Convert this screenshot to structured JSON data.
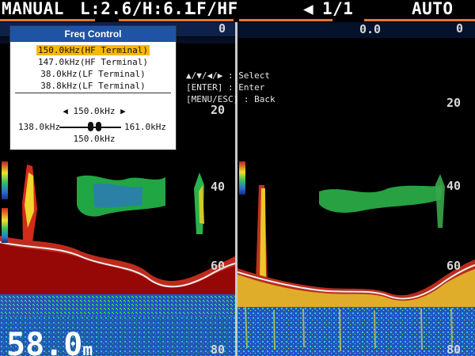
{
  "status_bar": {
    "mode": "MANUAL",
    "range": "L:2.6/H:6.1",
    "frequency_mode": "LF/HF",
    "page": "1/1",
    "gain_mode": "AUTO"
  },
  "left_panel": {
    "depth_labels": [
      "0",
      "20",
      "40",
      "60",
      "80"
    ],
    "depth_readout": "58.0",
    "depth_unit": "m"
  },
  "right_panel": {
    "top_label": "0.0",
    "depth_labels": [
      "0",
      "20",
      "40",
      "60",
      "80"
    ]
  },
  "freq_menu": {
    "title": "Freq Control",
    "items": [
      {
        "label": "150.0kHz(HF Terminal)",
        "selected": true
      },
      {
        "label": "147.0kHz(HF Terminal)",
        "selected": false
      },
      {
        "label": "38.0kHz(LF Terminal)",
        "selected": false
      },
      {
        "label": "38.8kHz(LF Terminal)",
        "selected": false
      }
    ],
    "slider": {
      "current": "150.0kHz",
      "min": "138.0kHz",
      "max": "161.0kHz",
      "value_label": "150.0kHz"
    }
  },
  "help": {
    "lines": [
      {
        "key": "▲/▼/◀/▶",
        "action": "Select"
      },
      {
        "key": "[ENTER]",
        "action": "Enter"
      },
      {
        "key": "[MENU/ESC]",
        "action": "Back"
      }
    ]
  },
  "colors": {
    "menu_title": "#1f53a6",
    "selected_item": "#f7b800",
    "echo_red": "#b51d1d",
    "echo_yellow": "#e5d61f",
    "echo_green": "#36c05b",
    "echo_blue": "#2f6fd3"
  }
}
